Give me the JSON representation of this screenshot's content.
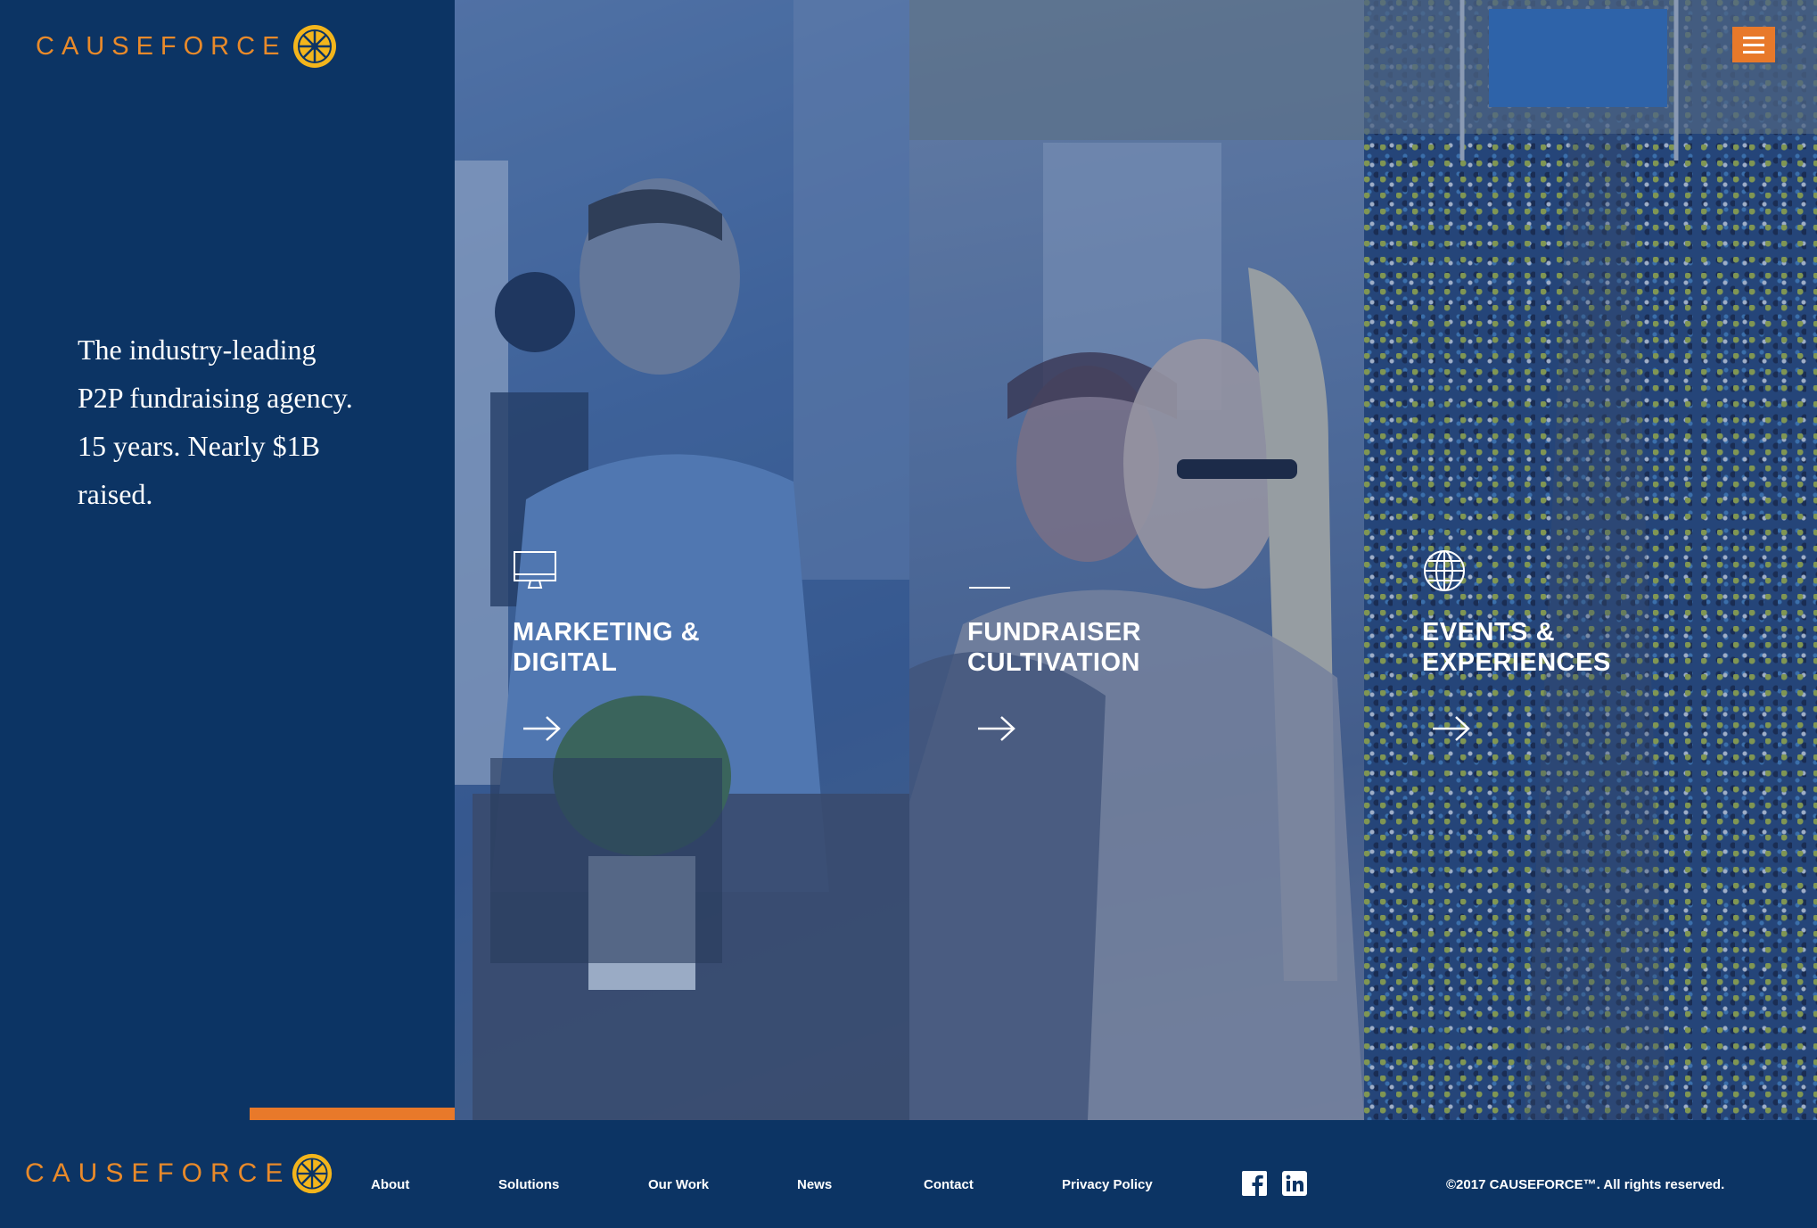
{
  "brand": {
    "name": "CAUSEFORCE",
    "accent": "#e8792a",
    "navy": "#0c3464"
  },
  "hero": {
    "tagline": [
      "The industry-leading",
      "P2P fundraising agency.",
      "15 years. Nearly $1B",
      "raised."
    ]
  },
  "panels": [
    {
      "title": "MARKETING &\nDIGITAL",
      "icon": "monitor-icon"
    },
    {
      "title": "FUNDRAISER\nCULTIVATION",
      "icon": "line-icon"
    },
    {
      "title": "EVENTS &\nEXPERIENCES",
      "icon": "globe-icon"
    }
  ],
  "header": {
    "menu_icon": "hamburger-icon"
  },
  "footer": {
    "nav": [
      "About",
      "Solutions",
      "Our Work",
      "News",
      "Contact",
      "Privacy Policy"
    ],
    "social": [
      "facebook-icon",
      "linkedin-icon"
    ],
    "copyright": "©2017 CAUSEFORCE™. All rights reserved."
  }
}
